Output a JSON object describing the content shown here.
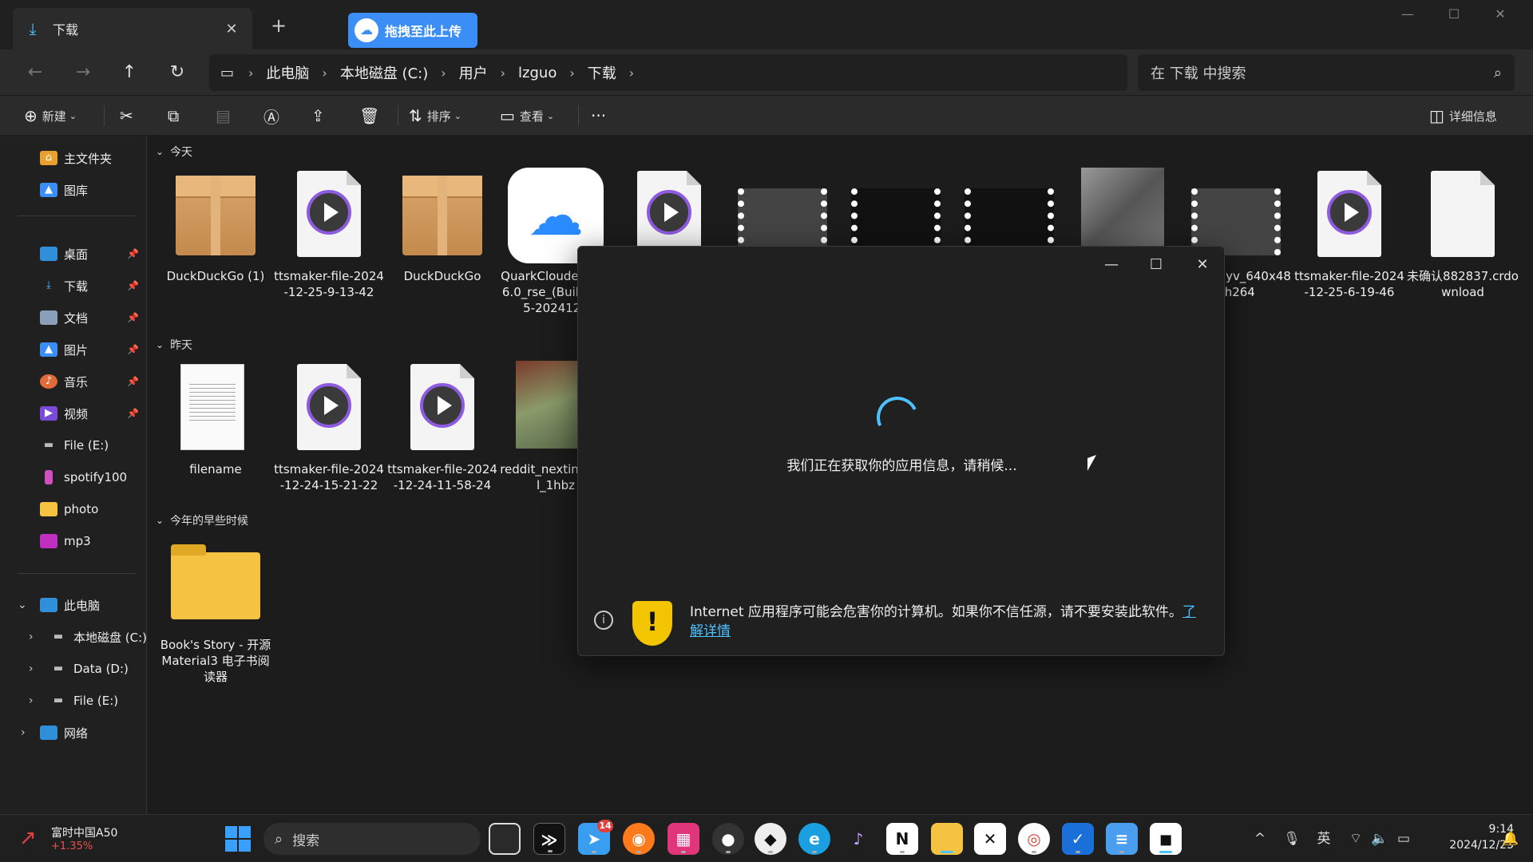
{
  "window": {
    "tab_title": "下载",
    "upload_label": "拖拽至此上传",
    "breadcrumb": [
      "此电脑",
      "本地磁盘 (C:)",
      "用户",
      "lzguo",
      "下载"
    ],
    "search_placeholder": "在 下载 中搜索"
  },
  "toolbar": {
    "new_label": "新建",
    "sort_label": "排序",
    "view_label": "查看",
    "details_label": "详细信息"
  },
  "sidebar": {
    "home": "主文件夹",
    "gallery": "图库",
    "quick": [
      {
        "label": "桌面",
        "icon": "desktop-icon"
      },
      {
        "label": "下载",
        "icon": "download-icon"
      },
      {
        "label": "文档",
        "icon": "document-icon"
      },
      {
        "label": "图片",
        "icon": "picture-icon"
      },
      {
        "label": "音乐",
        "icon": "music-icon"
      },
      {
        "label": "视频",
        "icon": "video-icon"
      }
    ],
    "others": [
      "File (E:)",
      "spotify100",
      "photo",
      "mp3"
    ],
    "this_pc": "此电脑",
    "drives": [
      "本地磁盘 (C:)",
      "Data (D:)",
      "File (E:)"
    ],
    "network": "网络"
  },
  "groups": {
    "today": "今天",
    "yesterday": "昨天",
    "earlier": "今年的早些时候"
  },
  "files_today": [
    {
      "name": "DuckDuckGo (1)",
      "kind": "box"
    },
    {
      "name": "ttsmaker-file-2024-12-25-9-13-42",
      "kind": "audio"
    },
    {
      "name": "DuckDuckGo",
      "kind": "box"
    },
    {
      "name": "QuarkCloude_v3.16.0_rse_(Build2015-2024121",
      "kind": "quark"
    },
    {
      "name": "",
      "kind": "audio"
    },
    {
      "name": "",
      "kind": "film"
    },
    {
      "name": "",
      "kind": "film-dark"
    },
    {
      "name": "",
      "kind": "film-dark"
    },
    {
      "name": "",
      "kind": "photo"
    },
    {
      "name": "be_fPr3yv_640x480h264",
      "kind": "film"
    },
    {
      "name": "ttsmaker-file-2024-12-25-6-19-46",
      "kind": "audio"
    },
    {
      "name": "未确认882837.crdownload",
      "kind": "blank"
    }
  ],
  "files_yesterday": [
    {
      "name": "filename",
      "kind": "text"
    },
    {
      "name": "ttsmaker-file-2024-12-24-15-21-22",
      "kind": "audio"
    },
    {
      "name": "ttsmaker-file-2024-12-24-11-58-24",
      "kind": "audio"
    },
    {
      "name": "reddit_nextinglevel_1hbz",
      "kind": "redpic"
    }
  ],
  "files_earlier": [
    {
      "name": "Book's Story - 开源 Material3 电子书阅读器",
      "kind": "folder"
    }
  ],
  "dialog": {
    "message": "我们正在获取你的应用信息，请稍候...",
    "warning": "Internet 应用程序可能会危害你的计算机。如果你不信任源，请不要安装此软件。",
    "link": "了解详情"
  },
  "taskbar": {
    "stock_name": "富时中国A50",
    "stock_change": "+1.35%",
    "search_placeholder": "搜索",
    "badge": "14",
    "ime": "英",
    "time": "9:14",
    "date": "2024/12/25"
  },
  "colors": {
    "accent": "#4cc2ff",
    "upload": "#3a8ef5",
    "warning": "#f3c500"
  }
}
